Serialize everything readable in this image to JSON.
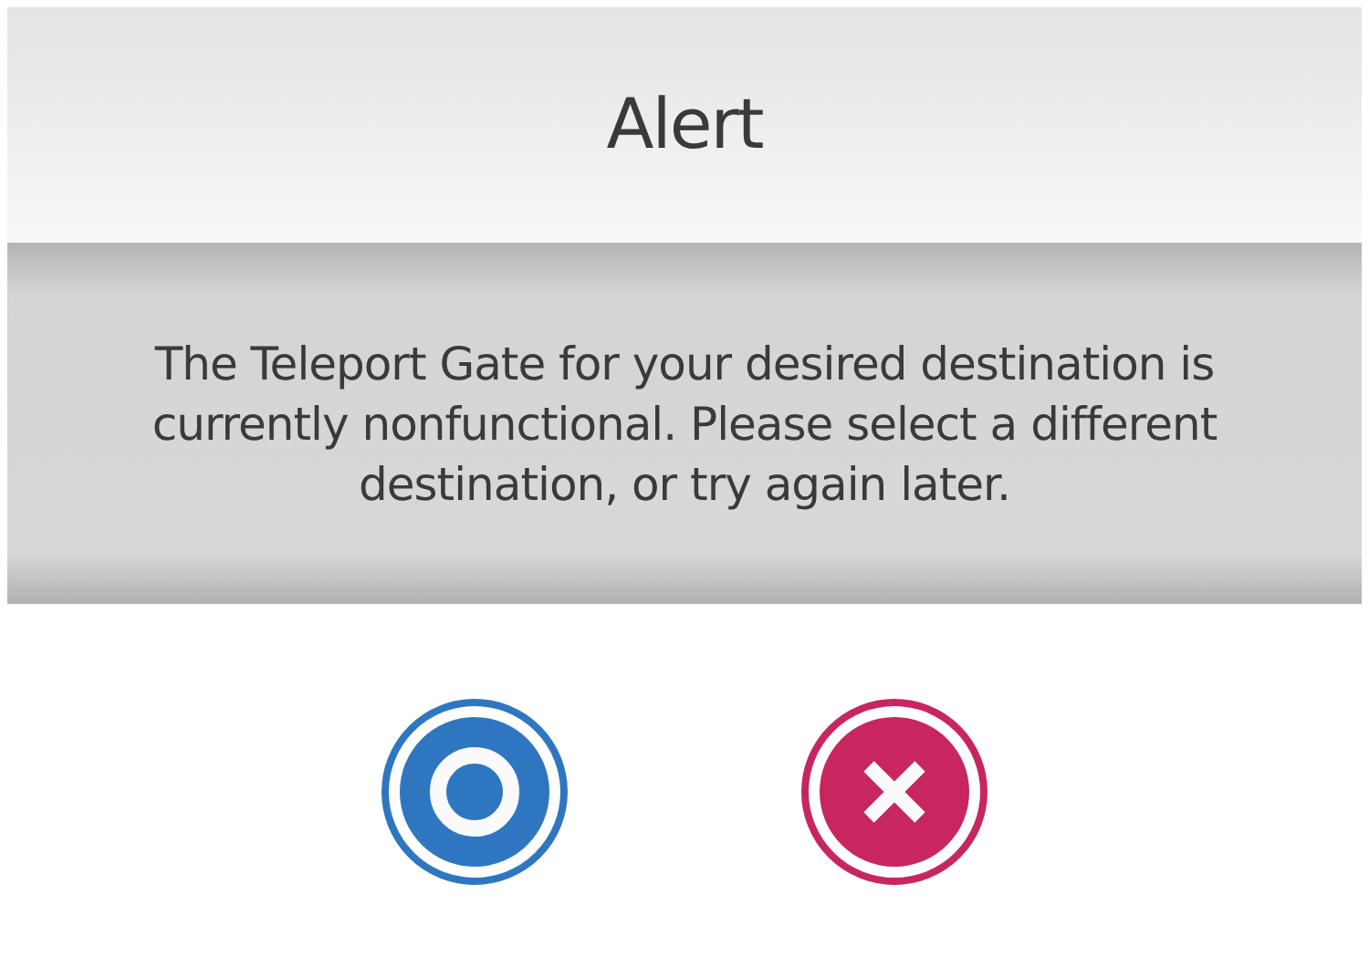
{
  "dialog": {
    "title": "Alert",
    "message": "The Teleport Gate for your desired destination is currently nonfunctional. Please select a different destination, or try again later.",
    "buttons": [
      {
        "kind": "confirm"
      },
      {
        "kind": "cancel"
      }
    ]
  }
}
